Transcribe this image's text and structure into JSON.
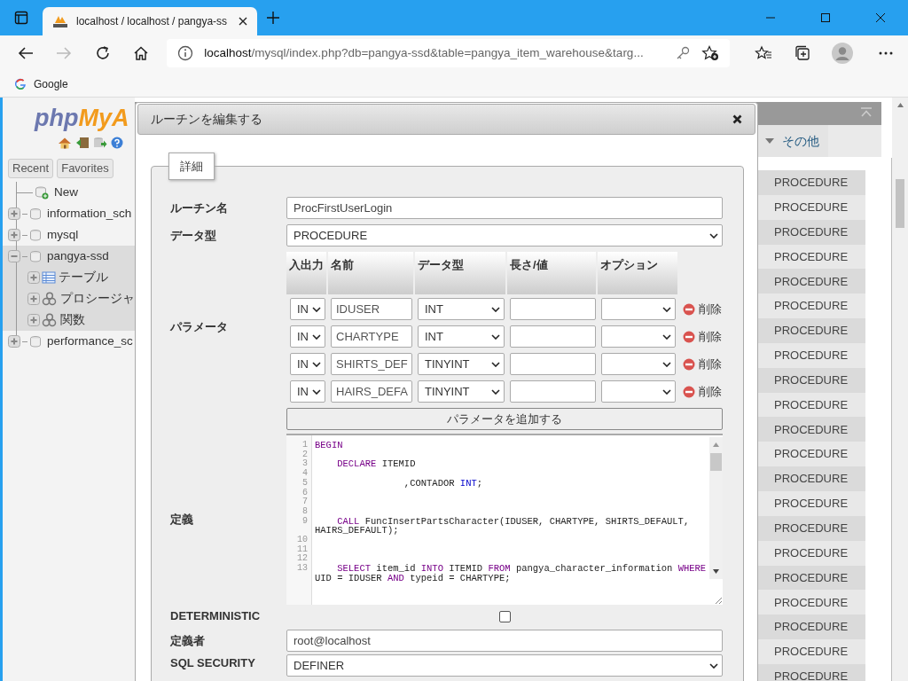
{
  "browser": {
    "tab": {
      "title": "localhost / localhost / pangya-ss"
    },
    "address": {
      "host": "localhost",
      "path": "/mysql/index.php?db=pangya-ssd&table=pangya_item_warehouse&targ..."
    },
    "forward_disabled": true,
    "bookmarks": [
      {
        "label": "Google"
      }
    ]
  },
  "sidebar": {
    "logo": {
      "part_1": "php",
      "part_2": "MyA"
    },
    "tabs": [
      {
        "label": "Recent"
      },
      {
        "label": "Favorites"
      }
    ],
    "tree": [
      {
        "label": "New",
        "kind": "new"
      },
      {
        "label": "information_sch",
        "kind": "db",
        "expanded": false,
        "selected": false
      },
      {
        "label": "mysql",
        "kind": "db",
        "expanded": false,
        "selected": false
      },
      {
        "label": "pangya-ssd",
        "kind": "db",
        "expanded": true,
        "selected": true,
        "children": [
          {
            "label": "テーブル",
            "kind": "table"
          },
          {
            "label": "プロシージャ",
            "kind": "routine"
          },
          {
            "label": "関数",
            "kind": "routine"
          }
        ]
      },
      {
        "label": "performance_sc",
        "kind": "db",
        "expanded": false,
        "selected": false
      }
    ]
  },
  "background_panel": {
    "tabs": [
      {
        "label": "その他",
        "kind": "menu"
      }
    ],
    "rows": [
      {
        "column_2": "PROCEDURE"
      },
      {
        "column_2": "PROCEDURE"
      },
      {
        "column_2": "PROCEDURE"
      },
      {
        "column_2": "PROCEDURE"
      },
      {
        "column_2": "PROCEDURE"
      },
      {
        "column_2": "PROCEDURE"
      },
      {
        "column_2": "PROCEDURE"
      },
      {
        "column_2": "PROCEDURE"
      },
      {
        "column_2": "PROCEDURE"
      },
      {
        "column_2": "PROCEDURE"
      },
      {
        "column_2": "PROCEDURE"
      },
      {
        "column_2": "PROCEDURE"
      },
      {
        "column_2": "PROCEDURE"
      },
      {
        "column_2": "PROCEDURE"
      },
      {
        "column_2": "PROCEDURE"
      },
      {
        "column_2": "PROCEDURE"
      },
      {
        "column_2": "PROCEDURE"
      },
      {
        "column_2": "PROCEDURE"
      },
      {
        "column_2": "PROCEDURE"
      },
      {
        "column_2": "PROCEDURE"
      },
      {
        "column_2": "PROCEDURE"
      }
    ]
  },
  "dialog": {
    "title": "ルーチンを編集する",
    "legend": "詳細",
    "routine_name": {
      "label": "ルーチン名",
      "value": "ProcFirstUserLogin"
    },
    "type": {
      "label": "データ型",
      "value": "PROCEDURE"
    },
    "parameters": {
      "label": "パラメータ",
      "columns": [
        "入出力",
        "名前",
        "データ型",
        "長さ/値",
        "オプション"
      ],
      "rows": [
        {
          "direction": "IN",
          "name": "IDUSER",
          "type": "INT",
          "remove": "削除"
        },
        {
          "direction": "IN",
          "name": "CHARTYPE",
          "type": "INT",
          "remove": "削除"
        },
        {
          "direction": "IN",
          "name": "SHIRTS_DEF",
          "type": "TINYINT",
          "remove": "削除"
        },
        {
          "direction": "IN",
          "name": "HAIRS_DEFA",
          "type": "TINYINT",
          "remove": "削除"
        }
      ],
      "add_button": "パラメータを追加する"
    },
    "definition": {
      "label": "定義",
      "lines": [
        {
          "num": "1",
          "segments": [
            {
              "kind": "keyword",
              "text": "BEGIN"
            }
          ]
        },
        {
          "num": "2"
        },
        {
          "num": "3",
          "segments": [
            {
              "kind": "keyword",
              "text": "    DECLARE"
            },
            {
              "kind": "plain",
              "text": " ITEMID"
            }
          ]
        },
        {
          "num": "4"
        },
        {
          "num": "5",
          "segments": [
            {
              "kind": "plain",
              "text": "                ,CONTADOR "
            },
            {
              "kind": "type",
              "text": "INT"
            },
            {
              "kind": "plain",
              "text": ";"
            }
          ]
        },
        {
          "num": "6"
        },
        {
          "num": "7"
        },
        {
          "num": "8"
        },
        {
          "num": "9",
          "segments": [
            {
              "kind": "keyword",
              "text": "    CALL"
            },
            {
              "kind": "plain",
              "text": " FuncInsertPartsCharacter(IDUSER, CHARTYPE, SHIRTS_DEFAULT, HAIRS_DEFAULT);"
            }
          ]
        },
        {
          "num": "10"
        },
        {
          "num": "11"
        },
        {
          "num": "12"
        },
        {
          "num": "13",
          "segments": [
            {
              "kind": "keyword",
              "text": "    SELECT"
            },
            {
              "kind": "plain",
              "text": " item_id "
            },
            {
              "kind": "keyword",
              "text": "INTO"
            },
            {
              "kind": "plain",
              "text": " ITEMID "
            },
            {
              "kind": "keyword",
              "text": "FROM"
            },
            {
              "kind": "plain",
              "text": " pangya_character_information "
            },
            {
              "kind": "keyword",
              "text": "WHERE"
            },
            {
              "kind": "plain",
              "text": " UID = IDUSER "
            },
            {
              "kind": "keyword",
              "text": "AND"
            },
            {
              "kind": "plain",
              "text": " typeid = CHARTYPE;"
            }
          ]
        }
      ]
    },
    "deterministic": {
      "label": "DETERMINISTIC",
      "checked": false
    },
    "definer": {
      "label": "定義者",
      "value": "root@localhost"
    },
    "security": {
      "label": "SQL SECURITY",
      "value": "DEFINER"
    }
  }
}
